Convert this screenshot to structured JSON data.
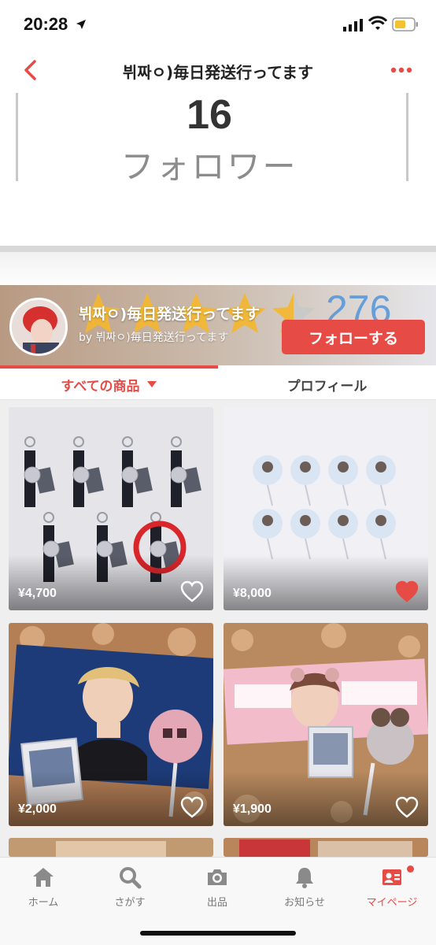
{
  "status_bar": {
    "time": "20:28"
  },
  "nav": {
    "title": "뷔짜ㅇ)毎日発送行ってます"
  },
  "profile_stats": {
    "followers_count": "16",
    "followers_label": "フォロワー"
  },
  "store": {
    "name": "뷔짜ㅇ)毎日発送行ってます",
    "by_line": "by 뷔짜ㅇ)毎日発送行ってます",
    "rating_count": "276",
    "rating_stars": 4.5,
    "follow_label": "フォローする"
  },
  "tabs": {
    "all_items": "すべての商品",
    "profile": "プロフィール"
  },
  "products": [
    {
      "price": "¥4,700",
      "liked": false
    },
    {
      "price": "¥8,000",
      "liked": true
    },
    {
      "price": "¥2,000",
      "liked": false
    },
    {
      "price": "¥1,900",
      "liked": false
    }
  ],
  "tab_bar": {
    "items": [
      {
        "label": "ホーム",
        "icon": "home-icon"
      },
      {
        "label": "さがす",
        "icon": "search-icon"
      },
      {
        "label": "出品",
        "icon": "camera-icon"
      },
      {
        "label": "お知らせ",
        "icon": "bell-icon"
      },
      {
        "label": "マイページ",
        "icon": "profile-card-icon"
      }
    ]
  },
  "colors": {
    "accent": "#e74b46",
    "rating_count": "#4a90d9"
  }
}
